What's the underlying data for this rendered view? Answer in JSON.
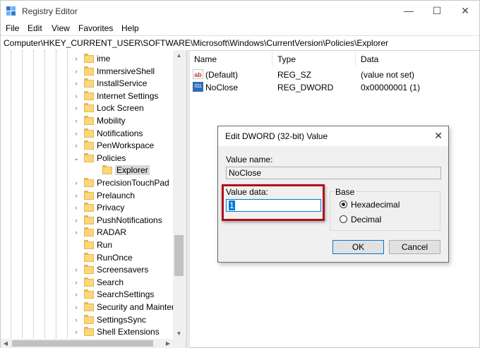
{
  "window": {
    "title": "Registry Editor"
  },
  "menu": [
    "File",
    "Edit",
    "View",
    "Favorites",
    "Help"
  ],
  "address": "Computer\\HKEY_CURRENT_USER\\SOFTWARE\\Microsoft\\Windows\\CurrentVersion\\Policies\\Explorer",
  "tree": {
    "items": [
      {
        "label": "ime",
        "expander": "›"
      },
      {
        "label": "ImmersiveShell",
        "expander": "›"
      },
      {
        "label": "InstallService",
        "expander": "›"
      },
      {
        "label": "Internet Settings",
        "expander": "›"
      },
      {
        "label": "Lock Screen",
        "expander": "›"
      },
      {
        "label": "Mobility",
        "expander": "›"
      },
      {
        "label": "Notifications",
        "expander": "›"
      },
      {
        "label": "PenWorkspace",
        "expander": "›"
      },
      {
        "label": "Policies",
        "expander": "⌄"
      },
      {
        "label": "Explorer",
        "expander": "",
        "selected": true
      },
      {
        "label": "PrecisionTouchPad",
        "expander": "›"
      },
      {
        "label": "Prelaunch",
        "expander": "›"
      },
      {
        "label": "Privacy",
        "expander": "›"
      },
      {
        "label": "PushNotifications",
        "expander": "›"
      },
      {
        "label": "RADAR",
        "expander": "›"
      },
      {
        "label": "Run",
        "expander": ""
      },
      {
        "label": "RunOnce",
        "expander": ""
      },
      {
        "label": "Screensavers",
        "expander": "›"
      },
      {
        "label": "Search",
        "expander": "›"
      },
      {
        "label": "SearchSettings",
        "expander": "›"
      },
      {
        "label": "Security and Mainter",
        "expander": "›"
      },
      {
        "label": "SettingsSync",
        "expander": "›"
      },
      {
        "label": "Shell Extensions",
        "expander": "›"
      }
    ]
  },
  "list": {
    "columns": [
      "Name",
      "Type",
      "Data"
    ],
    "rows": [
      {
        "name": "(Default)",
        "type": "REG_SZ",
        "data": "(value not set)",
        "icon": "string-value-icon",
        "icon_text": "ab"
      },
      {
        "name": "NoClose",
        "type": "REG_DWORD",
        "data": "0x00000001 (1)",
        "icon": "binary-value-icon",
        "icon_text": "011"
      }
    ]
  },
  "dialog": {
    "title": "Edit DWORD (32-bit) Value",
    "value_name_label": "Value name:",
    "value_name": "NoClose",
    "value_data_label": "Value data:",
    "value_data": "1",
    "base_label": "Base",
    "base_options": [
      "Hexadecimal",
      "Decimal"
    ],
    "base_selected": "Hexadecimal",
    "ok_label": "OK",
    "cancel_label": "Cancel"
  },
  "colors": {
    "highlight": "#b0101a",
    "accent": "#0078d7",
    "folder": "#fcd67a"
  }
}
